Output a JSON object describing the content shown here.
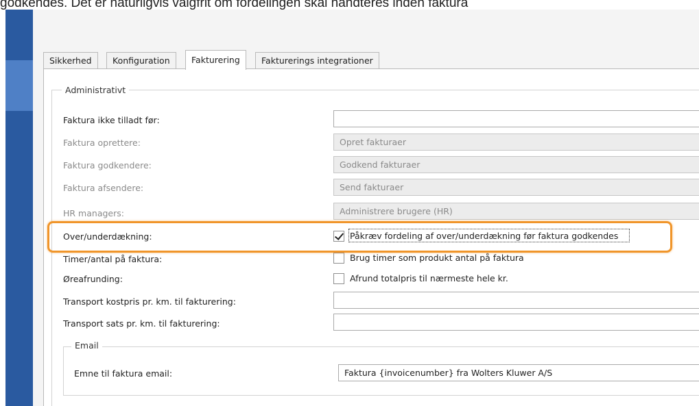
{
  "caption": "godkendes. Det er naturligvis valgfrit om fordelingen skal håndteres inden faktura",
  "tabs": [
    {
      "label": "Sikkerhed",
      "active": false
    },
    {
      "label": "Konfiguration",
      "active": false
    },
    {
      "label": "Fakturering",
      "active": true
    },
    {
      "label": "Fakturerings integrationer",
      "active": false
    }
  ],
  "admin": {
    "legend": "Administrativt",
    "faktura_ikke_tilladt_label": "Faktura ikke tilladt før:",
    "faktura_ikke_tilladt_value": "",
    "faktura_oprettere_label": "Faktura oprettere:",
    "faktura_oprettere_value": "Opret fakturaer",
    "faktura_godkendere_label": "Faktura godkendere:",
    "faktura_godkendere_value": "Godkend fakturaer",
    "faktura_afsendere_label": "Faktura afsendere:",
    "faktura_afsendere_value": "Send fakturaer",
    "hr_managers_label": "HR managers:",
    "hr_managers_value": "Administrere brugere (HR)",
    "over_under_label": "Over/underdækning:",
    "over_under_checkbox_label": "Påkræv fordeling af over/underdækning før faktura godkendes",
    "over_under_checked": true,
    "timer_antal_label": "Timer/antal på faktura:",
    "timer_antal_checkbox_label": "Brug timer som produkt antal på faktura",
    "timer_antal_checked": false,
    "oereafrunding_label": "Øreafrunding:",
    "oereafrunding_checkbox_label": "Afrund totalpris til nærmeste hele kr.",
    "oereafrunding_checked": false,
    "transport_kostpris_label": "Transport kostpris pr. km. til fakturering:",
    "transport_kostpris_value": "",
    "transport_sats_label": "Transport sats pr. km. til fakturering:",
    "transport_sats_value": ""
  },
  "email": {
    "legend": "Email",
    "emne_label": "Emne til faktura email:",
    "emne_value": "Faktura {invoicenumber} fra Wolters Kluwer A/S"
  },
  "colors": {
    "sidebar": "#2a5aa0",
    "sidebar_highlight": "#4f80c6",
    "highlight_ring": "#f0952a"
  }
}
